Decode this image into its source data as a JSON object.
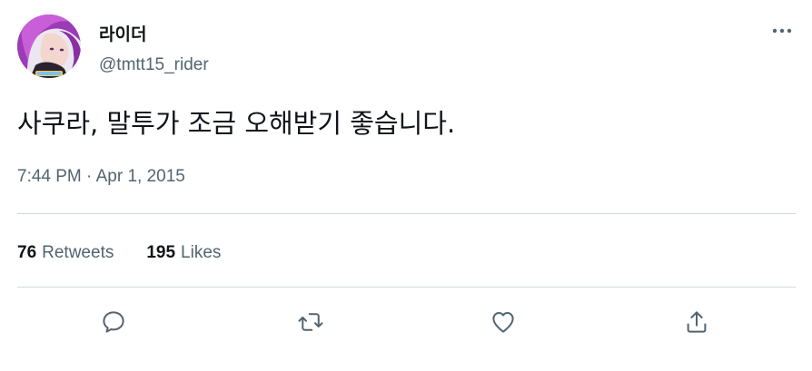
{
  "author": {
    "display_name": "라이더",
    "handle": "@tmtt15_rider"
  },
  "tweet": {
    "text": "사쿠라, 말투가 조금 오해받기 좋습니다.",
    "time": "7:44 PM",
    "separator": "·",
    "date": "Apr 1, 2015"
  },
  "stats": {
    "retweets_count": "76",
    "retweets_label": "Retweets",
    "likes_count": "195",
    "likes_label": "Likes"
  },
  "icons": {
    "more": "more-icon",
    "reply": "reply-icon",
    "retweet": "retweet-icon",
    "like": "heart-icon",
    "share": "share-icon"
  },
  "colors": {
    "text_primary": "#0f1419",
    "text_secondary": "#536471",
    "divider": "#cfd9de",
    "avatar_hair": "#9b3bb5"
  }
}
